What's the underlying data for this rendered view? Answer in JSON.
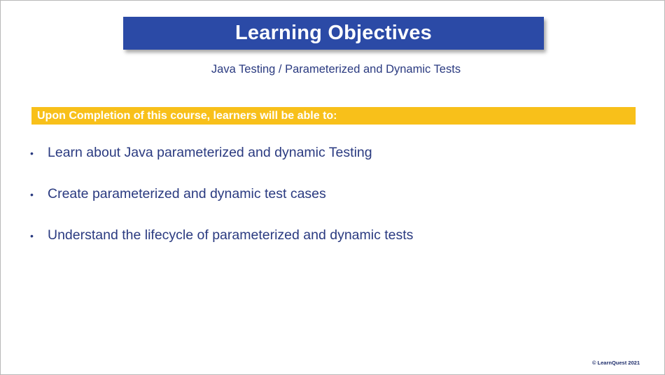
{
  "slide": {
    "title": "Learning Objectives",
    "subtitle": "Java Testing / Parameterized and Dynamic Tests",
    "highlight": "Upon Completion of this course, learners will be able to:",
    "objectives": [
      {
        "bullet": "•",
        "text": "Learn about Java parameterized and dynamic Testing"
      },
      {
        "bullet": "•",
        "text": "Create parameterized and dynamic test cases"
      },
      {
        "bullet": "•",
        "text": "Understand the lifecycle of parameterized and dynamic tests"
      }
    ],
    "copyright": "© LearnQuest 2021"
  },
  "colors": {
    "title_banner": "#2b4aa6",
    "highlight_bar": "#f8c01a",
    "body_text": "#2a3a80"
  }
}
